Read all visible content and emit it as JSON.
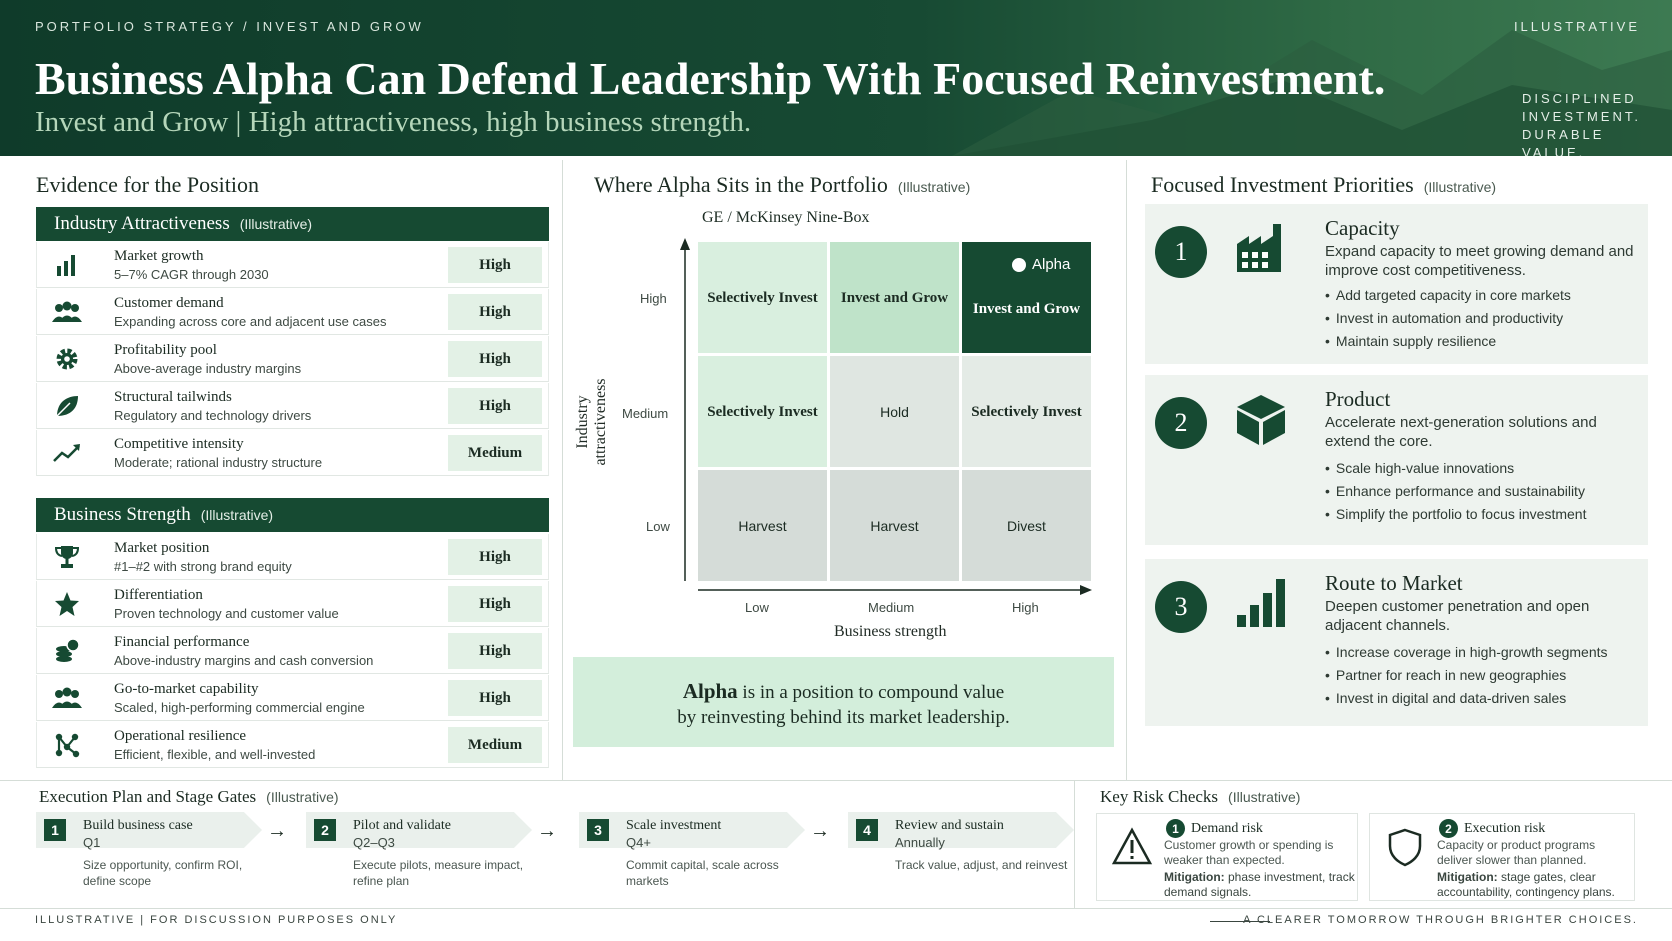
{
  "header": {
    "kicker": "PORTFOLIO STRATEGY  /  INVEST AND GROW",
    "tag": "ILLUSTRATIVE",
    "title": "Business Alpha Can Defend Leadership With Focused Reinvestment.",
    "subtitle": "Invest and Grow | High attractiveness, high business strength.",
    "tagline": [
      "DISCIPLINED",
      "INVESTMENT.",
      "DURABLE VALUE."
    ]
  },
  "evidence": {
    "title": "Evidence for the Position",
    "industry": {
      "title": "Industry Attractiveness",
      "note": "(Illustrative)",
      "rows": [
        {
          "icon": "bar-chart-icon",
          "name": "Market growth",
          "desc": "5–7% CAGR through 2030",
          "rating": "High"
        },
        {
          "icon": "people-icon",
          "name": "Customer demand",
          "desc": "Expanding across core and adjacent use cases",
          "rating": "High"
        },
        {
          "icon": "gear-icon",
          "name": "Profitability pool",
          "desc": "Above-average industry margins",
          "rating": "High"
        },
        {
          "icon": "leaf-icon",
          "name": "Structural tailwinds",
          "desc": "Regulatory and technology drivers",
          "rating": "High"
        },
        {
          "icon": "trend-line-icon",
          "name": "Competitive intensity",
          "desc": "Moderate; rational industry structure",
          "rating": "Medium"
        }
      ]
    },
    "business": {
      "title": "Business Strength",
      "note": "(Illustrative)",
      "rows": [
        {
          "icon": "trophy-icon",
          "name": "Market position",
          "desc": "#1–#2 with strong brand equity",
          "rating": "High"
        },
        {
          "icon": "star-icon",
          "name": "Differentiation",
          "desc": "Proven technology and customer value",
          "rating": "High"
        },
        {
          "icon": "coins-icon",
          "name": "Financial performance",
          "desc": "Above-industry margins and cash conversion",
          "rating": "High"
        },
        {
          "icon": "team-icon",
          "name": "Go-to-market capability",
          "desc": "Scaled, high-performing commercial engine",
          "rating": "High"
        },
        {
          "icon": "network-icon",
          "name": "Operational resilience",
          "desc": "Efficient, flexible, and well-invested",
          "rating": "Medium"
        }
      ]
    }
  },
  "matrix": {
    "title": "Where Alpha Sits in the Portfolio",
    "note": "(Illustrative)",
    "subtitle": "GE / McKinsey Nine-Box",
    "y_label": "Industry attractiveness",
    "x_label": "Business strength",
    "y_ticks": [
      "High",
      "Medium",
      "Low"
    ],
    "x_ticks": [
      "Low",
      "Medium",
      "High"
    ],
    "cells": [
      [
        "Selectively Invest",
        "Invest and Grow",
        "Invest and Grow"
      ],
      [
        "Selectively Invest",
        "Hold",
        "Selectively Invest"
      ],
      [
        "Harvest",
        "Harvest",
        "Divest"
      ]
    ],
    "marker": "Alpha",
    "callout_bold": "Alpha",
    "callout_line1": " is in a position to compound value",
    "callout_line2": "by reinvesting behind its market leadership."
  },
  "priorities": {
    "title": "Focused Investment Priorities",
    "note": "(Illustrative)",
    "items": [
      {
        "num": "1",
        "icon": "factory-icon",
        "title": "Capacity",
        "desc": "Expand capacity to meet growing demand and improve cost competitiveness.",
        "bullets": [
          "Add targeted capacity in core markets",
          "Invest in automation and productivity",
          "Maintain supply resilience"
        ]
      },
      {
        "num": "2",
        "icon": "cube-icon",
        "title": "Product",
        "desc": "Accelerate next-generation solutions and extend the core.",
        "bullets": [
          "Scale high-value innovations",
          "Enhance performance and sustainability",
          "Simplify the portfolio to focus investment"
        ]
      },
      {
        "num": "3",
        "icon": "growth-bars-icon",
        "title": "Route to Market",
        "desc": "Deepen customer penetration and open adjacent channels.",
        "bullets": [
          "Increase coverage in high-growth segments",
          "Partner for reach in new geographies",
          "Invest in digital and data-driven sales"
        ]
      }
    ]
  },
  "execution": {
    "title": "Execution Plan and Stage Gates",
    "note": "(Illustrative)",
    "stages": [
      {
        "num": "1",
        "title": "Build business case",
        "when": "Q1",
        "desc": "Size opportunity, confirm ROI, define scope"
      },
      {
        "num": "2",
        "title": "Pilot and validate",
        "when": "Q2–Q3",
        "desc": "Execute pilots, measure impact, refine plan"
      },
      {
        "num": "3",
        "title": "Scale investment",
        "when": "Q4+",
        "desc": "Commit capital, scale across markets"
      },
      {
        "num": "4",
        "title": "Review and sustain",
        "when": "Annually",
        "desc": "Track value, adjust, and reinvest"
      }
    ]
  },
  "risks": {
    "title": "Key Risk Checks",
    "note": "(Illustrative)",
    "items": [
      {
        "num": "1",
        "icon": "warning-icon",
        "title": "Demand risk",
        "desc": "Customer growth or spending is weaker than expected.",
        "mit_label": "Mitigation:",
        "mit": " phase investment, track demand signals."
      },
      {
        "num": "2",
        "icon": "shield-icon",
        "title": "Execution risk",
        "desc": "Capacity or product programs deliver slower than planned.",
        "mit_label": "Mitigation:",
        "mit": " stage gates, clear accountability, contingency plans."
      }
    ]
  },
  "footer": {
    "left": "ILLUSTRATIVE  |  FOR DISCUSSION PURPOSES ONLY",
    "right": "A CLEARER TOMORROW  THROUGH BRIGHTER CHOICES."
  }
}
